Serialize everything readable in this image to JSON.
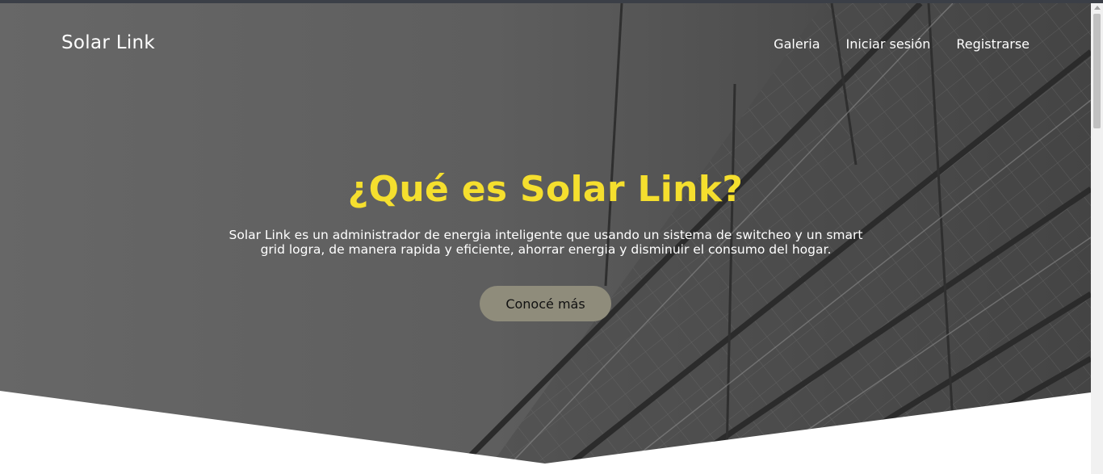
{
  "header": {
    "brand": "Solar Link",
    "nav": [
      "Galeria",
      "Iniciar sesión",
      "Registrarse"
    ]
  },
  "hero": {
    "title": "¿Qué es Solar Link?",
    "description": "Solar Link es un administrador de energia inteligente que usando un sistema de switcheo y un smart grid logra, de manera rapida y eficiente, ahorrar energia y disminuir el consumo del hogar.",
    "cta_label": "Conocé más",
    "background": "solar-panels-photo"
  },
  "colors": {
    "accent": "#f5df2e",
    "overlay": "#5c5c5c",
    "button": "#8f8c7b",
    "text": "#ffffff"
  }
}
